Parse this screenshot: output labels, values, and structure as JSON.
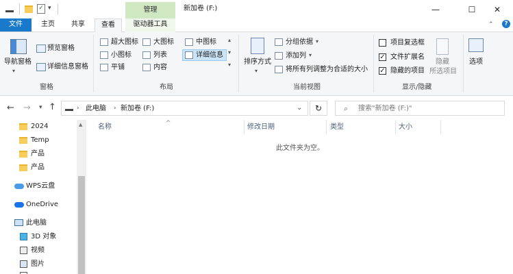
{
  "window": {
    "title": "新加卷 (F:)",
    "context_tab": "管理",
    "minimize": "—",
    "maximize": "☐",
    "close": "✕"
  },
  "tabs": {
    "file": "文件",
    "home": "主页",
    "share": "共享",
    "view": "查看",
    "drive_tools": "驱动器工具"
  },
  "ribbon": {
    "panes": {
      "label": "窗格",
      "nav_pane": "导航窗格",
      "preview": "预览窗格",
      "details": "详细信息窗格"
    },
    "layout": {
      "label": "布局",
      "extra_large": "超大图标",
      "large": "大图标",
      "medium": "中图标",
      "small": "小图标",
      "list": "列表",
      "details": "详细信息",
      "tiles": "平铺",
      "content": "内容"
    },
    "current_view": {
      "label": "当前视图",
      "sort_by": "排序方式",
      "group_by": "分组依据",
      "add_columns": "添加列",
      "fit_columns": "将所有列调整为合适的大小"
    },
    "show_hide": {
      "label": "显示/隐藏",
      "item_checkboxes": "项目复选框",
      "file_extensions": "文件扩展名",
      "hidden_items": "隐藏的项目",
      "hide_selected": "隐藏",
      "hide_selected_2": "所选项目",
      "options": "选项"
    }
  },
  "address": {
    "this_pc": "此电脑",
    "drive": "新加卷 (F:)",
    "search_placeholder": "搜索\"新加卷 (F:)\""
  },
  "nav": {
    "items": [
      "2024",
      "Temp",
      "产品",
      "产品"
    ],
    "wps": "WPS云盘",
    "onedrive": "OneDrive",
    "this_pc": "此电脑",
    "objects3d": "3D 对象",
    "videos": "视频",
    "pictures": "图片"
  },
  "columns": {
    "name": "名称",
    "modified": "修改日期",
    "type": "类型",
    "size": "大小"
  },
  "empty_message": "此文件夹为空。"
}
